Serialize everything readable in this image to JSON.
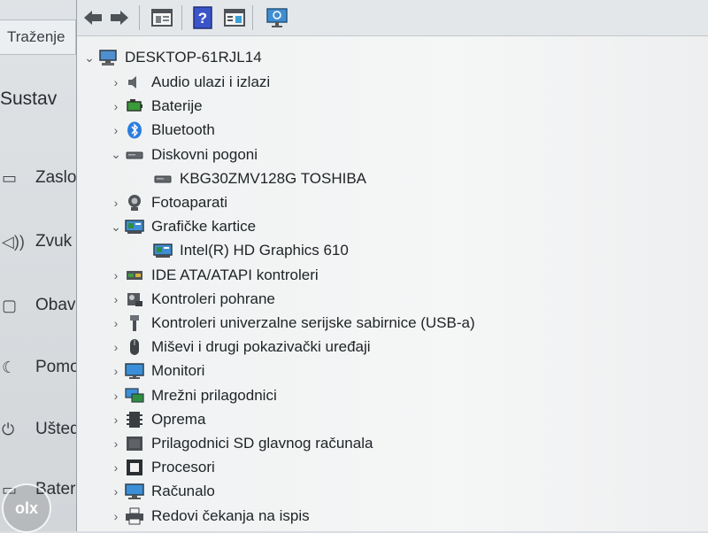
{
  "background_window": {
    "search_text": "Traženje",
    "heading": "Sustav",
    "items": [
      {
        "icon": "monitor-icon",
        "label": "Zaslon"
      },
      {
        "icon": "speaker-icon",
        "label": "Zvuk"
      },
      {
        "icon": "notification-icon",
        "label": "Obav"
      },
      {
        "icon": "moon-icon",
        "label": "Pomo"
      },
      {
        "icon": "power-icon",
        "label": "Ušted"
      },
      {
        "icon": "battery-icon",
        "label": "Bater"
      }
    ]
  },
  "device_manager": {
    "toolbar": [
      {
        "name": "back-icon"
      },
      {
        "name": "forward-icon"
      },
      {
        "name": "properties-icon"
      },
      {
        "name": "help-icon"
      },
      {
        "name": "view-icon"
      },
      {
        "name": "scan-icon"
      }
    ],
    "root": {
      "label": "DESKTOP-61RJL14",
      "expanded": true
    },
    "categories": [
      {
        "label": "Audio ulazi i izlazi",
        "icon": "audio-icon",
        "expanded": false,
        "children": []
      },
      {
        "label": "Baterije",
        "icon": "battery-icon",
        "expanded": false,
        "children": []
      },
      {
        "label": "Bluetooth",
        "icon": "bluetooth-icon",
        "expanded": false,
        "children": []
      },
      {
        "label": "Diskovni pogoni",
        "icon": "disk-drive-icon",
        "expanded": true,
        "children": [
          {
            "label": "KBG30ZMV128G TOSHIBA",
            "icon": "disk-drive-icon"
          }
        ]
      },
      {
        "label": "Fotoaparati",
        "icon": "camera-icon",
        "expanded": false,
        "children": []
      },
      {
        "label": "Grafičke kartice",
        "icon": "display-adapter-icon",
        "expanded": true,
        "children": [
          {
            "label": "Intel(R) HD Graphics 610",
            "icon": "display-adapter-icon"
          }
        ]
      },
      {
        "label": "IDE ATA/ATAPI kontroleri",
        "icon": "ide-controller-icon",
        "expanded": false,
        "children": []
      },
      {
        "label": "Kontroleri pohrane",
        "icon": "storage-controller-icon",
        "expanded": false,
        "children": []
      },
      {
        "label": "Kontroleri univerzalne serijske sabirnice (USB-a)",
        "icon": "usb-icon",
        "expanded": false,
        "children": []
      },
      {
        "label": "Miševi i drugi pokazivački uređaji",
        "icon": "mouse-icon",
        "expanded": false,
        "children": []
      },
      {
        "label": "Monitori",
        "icon": "monitor-icon",
        "expanded": false,
        "children": []
      },
      {
        "label": "Mrežni prilagodnici",
        "icon": "network-adapter-icon",
        "expanded": false,
        "children": []
      },
      {
        "label": "Oprema",
        "icon": "firmware-icon",
        "expanded": false,
        "children": []
      },
      {
        "label": "Prilagodnici SD glavnog računala",
        "icon": "sd-host-icon",
        "expanded": false,
        "children": []
      },
      {
        "label": "Procesori",
        "icon": "processor-icon",
        "expanded": false,
        "children": []
      },
      {
        "label": "Računalo",
        "icon": "computer-icon",
        "expanded": false,
        "children": []
      },
      {
        "label": "Redovi čekanja na ispis",
        "icon": "print-queue-icon",
        "expanded": false,
        "children": []
      }
    ]
  },
  "watermark": {
    "text": "olx"
  }
}
